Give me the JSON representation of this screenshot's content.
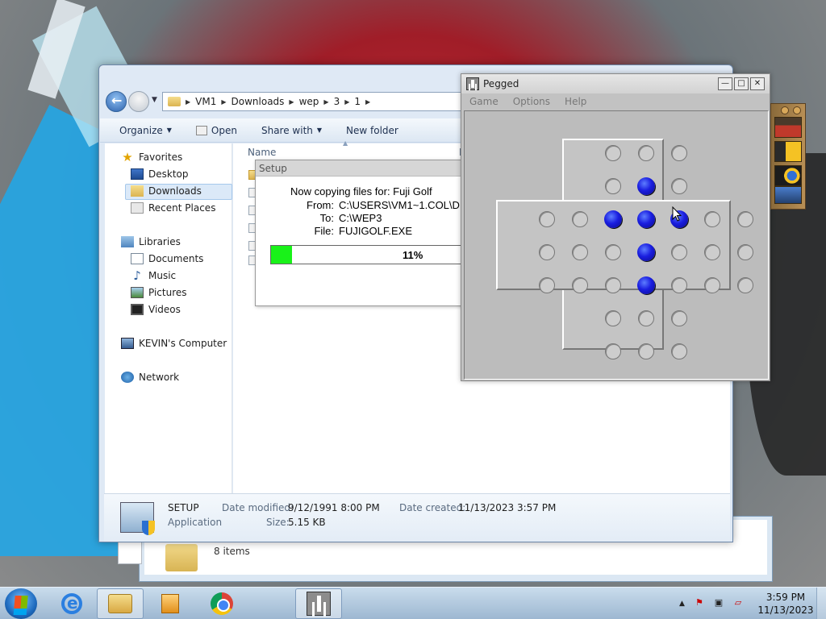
{
  "explorer": {
    "breadcrumb": [
      "VM1",
      "Downloads",
      "wep",
      "3",
      "1"
    ],
    "toolbar": {
      "organize": "Organize",
      "open": "Open",
      "share_with": "Share with",
      "new_folder": "New folder"
    },
    "nav": {
      "favorites": "Favorites",
      "desktop": "Desktop",
      "downloads": "Downloads",
      "recent_places": "Recent Places",
      "libraries": "Libraries",
      "documents": "Documents",
      "music": "Music",
      "pictures": "Pictures",
      "videos": "Videos",
      "computer": "KEVIN's Computer",
      "network": "Network"
    },
    "columns": {
      "name": "Name",
      "date": "D"
    },
    "details": {
      "name": "SETUP",
      "type": "Application",
      "date_modified_label": "Date modified:",
      "date_modified": "9/12/1991 8:00 PM",
      "size_label": "Size:",
      "size": "5.15 KB",
      "date_created_label": "Date created:",
      "date_created": "11/13/2023 3:57 PM"
    }
  },
  "back_window": {
    "items_count": "8 items"
  },
  "setup_dialog": {
    "title": "Setup",
    "copying_line": "Now copying files for:  Fuji Golf",
    "from_label": "From:",
    "from": "C:\\USERS\\VM1~1.COL\\D",
    "to_label": "To:",
    "to": "C:\\WEP3",
    "file_label": "File:",
    "file": "FUJIGOLF.EXE",
    "progress_percent": 11,
    "progress_text": "11%"
  },
  "pegged": {
    "title": "Pegged",
    "menu": [
      "Game",
      "Options",
      "Help"
    ],
    "board": {
      "rows": [
        "..OOO..",
        "..OXO..",
        "OOXXXOO",
        "OOOXOOO",
        "OOOXOOO",
        "..OOO..",
        "..OOO.."
      ]
    }
  },
  "taskbar": {
    "apps": [
      "internet-explorer",
      "windows-explorer",
      "media-player",
      "chrome",
      "pegged"
    ],
    "clock_time": "3:59 PM",
    "clock_date": "11/13/2023"
  }
}
